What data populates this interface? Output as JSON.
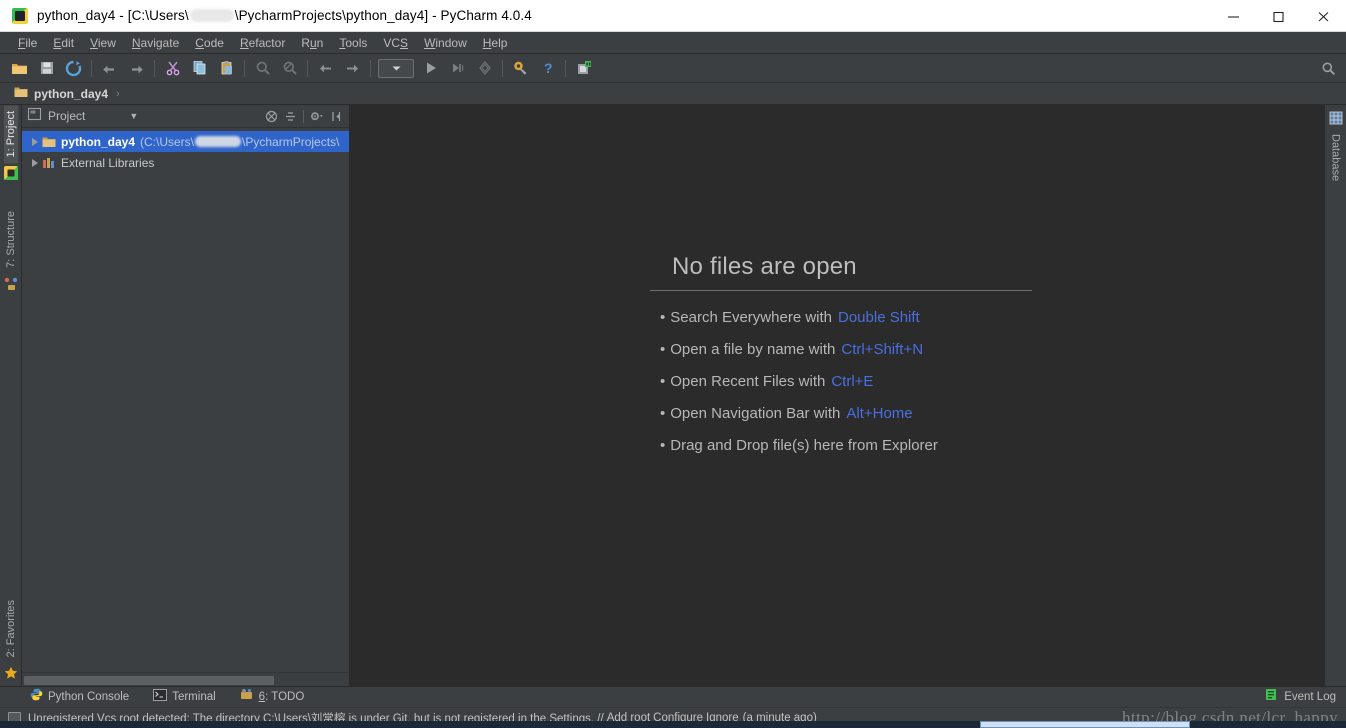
{
  "window": {
    "title_prefix": "python_day4 - [C:\\Users\\",
    "title_suffix": "\\PycharmProjects\\python_day4] - PyCharm 4.0.4",
    "app_icon": "pycharm-logo-icon",
    "minimize_label": "–",
    "maximize_label": "□",
    "close_label": "✕"
  },
  "menubar": {
    "items": [
      {
        "label": "File",
        "mnemonic": "F",
        "rest": "ile"
      },
      {
        "label": "Edit",
        "mnemonic": "E",
        "rest": "dit"
      },
      {
        "label": "View",
        "mnemonic": "V",
        "rest": "iew"
      },
      {
        "label": "Navigate",
        "mnemonic": "N",
        "rest": "avigate"
      },
      {
        "label": "Code",
        "mnemonic": "C",
        "rest": "ode"
      },
      {
        "label": "Refactor",
        "mnemonic": "R",
        "rest": "efactor"
      },
      {
        "label": "Run",
        "mnemonic": "u",
        "pre": "R",
        "rest": "n"
      },
      {
        "label": "Tools",
        "mnemonic": "T",
        "rest": "ools"
      },
      {
        "label": "VCS",
        "mnemonic": "S",
        "pre": "VC",
        "rest": ""
      },
      {
        "label": "Window",
        "mnemonic": "W",
        "rest": "indow"
      },
      {
        "label": "Help",
        "mnemonic": "H",
        "rest": "elp"
      }
    ]
  },
  "toolbar": {
    "buttons": [
      {
        "name": "open-folder-icon",
        "tooltip": "Open"
      },
      {
        "name": "save-all-icon",
        "tooltip": "Save All"
      },
      {
        "name": "synchronize-icon",
        "tooltip": "Synchronize"
      },
      {
        "name": "undo-arrow-icon",
        "tooltip": "Undo"
      },
      {
        "name": "redo-arrow-icon",
        "tooltip": "Redo"
      },
      {
        "name": "cut-scissors-icon",
        "tooltip": "Cut"
      },
      {
        "name": "copy-icon",
        "tooltip": "Copy"
      },
      {
        "name": "paste-icon",
        "tooltip": "Paste"
      },
      {
        "name": "find-icon",
        "tooltip": "Find"
      },
      {
        "name": "replace-icon",
        "tooltip": "Replace"
      },
      {
        "name": "back-icon",
        "tooltip": "Back"
      },
      {
        "name": "forward-icon",
        "tooltip": "Forward"
      },
      {
        "name": "run-icon",
        "tooltip": "Run"
      },
      {
        "name": "debug-icon",
        "tooltip": "Debug"
      },
      {
        "name": "coverage-icon",
        "tooltip": "Run with Coverage"
      },
      {
        "name": "settings-wrench-icon",
        "tooltip": "Settings"
      },
      {
        "name": "help-icon",
        "tooltip": "Help"
      },
      {
        "name": "plugin-icon",
        "tooltip": "Plugins"
      }
    ],
    "run_config_dropdown": "",
    "search_icon": "search-icon"
  },
  "breadcrumb": {
    "folder_icon": "folder-icon",
    "label": "python_day4",
    "chevron": "›"
  },
  "left_rail": {
    "tabs": [
      {
        "label": "1: Project",
        "mnemonic": "1",
        "active": true,
        "icon": "project-icon"
      },
      {
        "label": "7: Structure",
        "mnemonic": "7",
        "active": false,
        "icon": "structure-icon"
      },
      {
        "label": "2: Favorites",
        "mnemonic": "2",
        "active": false,
        "icon": "star-icon"
      }
    ]
  },
  "right_rail": {
    "tabs": [
      {
        "label": "Database",
        "active": false,
        "icon": "database-icon"
      }
    ]
  },
  "project_panel": {
    "title": "Project",
    "dropdown_arrow": "▼",
    "tools": [
      {
        "name": "collapse-all-icon",
        "tooltip": "Collapse All"
      },
      {
        "name": "scroll-to-source-icon",
        "tooltip": "Scroll from Source"
      },
      {
        "name": "settings-gear-icon",
        "tooltip": "Settings"
      },
      {
        "name": "hide-panel-icon",
        "tooltip": "Hide"
      }
    ],
    "tree": [
      {
        "label": "python_day4",
        "bold": true,
        "path_prefix": "(C:\\Users\\",
        "path_suffix": "\\PycharmProjects\\",
        "selected": true,
        "icon": "folder-icon",
        "expander": "collapsed"
      },
      {
        "label": "External Libraries",
        "bold": false,
        "path_prefix": "",
        "path_suffix": "",
        "selected": false,
        "icon": "library-icon",
        "expander": "collapsed"
      }
    ]
  },
  "editor": {
    "empty_title": "No files are open",
    "hints": [
      {
        "bullet": "•",
        "text": "Search Everywhere with",
        "key": "Double Shift"
      },
      {
        "bullet": "•",
        "text": "Open a file by name with",
        "key": "Ctrl+Shift+N"
      },
      {
        "bullet": "•",
        "text": "Open Recent Files with",
        "key": "Ctrl+E"
      },
      {
        "bullet": "•",
        "text": "Open Navigation Bar with",
        "key": "Alt+Home"
      },
      {
        "bullet": "•",
        "text": "Drag and Drop file(s) here from Explorer",
        "key": ""
      }
    ],
    "key_color": "#4a6ee0"
  },
  "bottom_toolwindows": {
    "items": [
      {
        "label": "Python Console",
        "icon": "python-icon",
        "mnemonic": ""
      },
      {
        "label": "Terminal",
        "icon": "terminal-icon",
        "mnemonic": ""
      },
      {
        "label": "6: TODO",
        "icon": "todo-icon",
        "mnemonic": "6"
      }
    ],
    "event_log": {
      "label": "Event Log",
      "icon": "event-log-icon"
    }
  },
  "statusbar": {
    "message": "Unregistered Vcs root detected: The directory C:\\Users\\刘常榕 is under Git, but is not registered in the Settings. //",
    "links": [
      "Add root",
      "Configure",
      "Ignore"
    ],
    "time": "(a minute ago)",
    "watermark": "http://blog.csdn.net/lcr_happy"
  }
}
